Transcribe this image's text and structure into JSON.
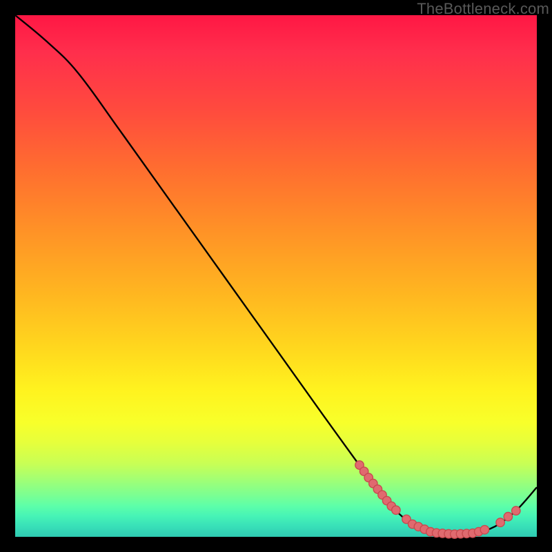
{
  "watermark": "TheBottleneck.com",
  "colors": {
    "page_bg": "#000000",
    "gradient_top": "#ff1744",
    "gradient_mid": "#fff31f",
    "gradient_bottom": "#2fcab2",
    "curve": "#000000",
    "dot_fill": "#e06a6f",
    "dot_stroke": "#c84a4f",
    "watermark": "#595959"
  },
  "chart_data": {
    "type": "line",
    "title": "",
    "xlabel": "",
    "ylabel": "",
    "x_range": [
      0,
      100
    ],
    "y_range": [
      0,
      100
    ],
    "curve": [
      {
        "x": 0,
        "y": 100
      },
      {
        "x": 6,
        "y": 95
      },
      {
        "x": 12,
        "y": 89
      },
      {
        "x": 20,
        "y": 78
      },
      {
        "x": 30,
        "y": 64
      },
      {
        "x": 40,
        "y": 50
      },
      {
        "x": 50,
        "y": 36
      },
      {
        "x": 60,
        "y": 22
      },
      {
        "x": 68,
        "y": 11
      },
      {
        "x": 72,
        "y": 6
      },
      {
        "x": 76,
        "y": 2.5
      },
      {
        "x": 80,
        "y": 0.8
      },
      {
        "x": 84,
        "y": 0.5
      },
      {
        "x": 88,
        "y": 0.7
      },
      {
        "x": 92,
        "y": 2
      },
      {
        "x": 96,
        "y": 5
      },
      {
        "x": 100,
        "y": 9.5
      }
    ],
    "dot_clusters": [
      {
        "range_x": [
          66,
          73
        ],
        "count": 9,
        "y_center": 9
      },
      {
        "range_x": [
          75,
          90
        ],
        "count": 14,
        "y_center": 0.8
      },
      {
        "range_x": [
          93,
          96
        ],
        "count": 3,
        "y_center": 3.5
      }
    ],
    "curve_minimum": {
      "x": 84,
      "y": 0.5
    }
  }
}
